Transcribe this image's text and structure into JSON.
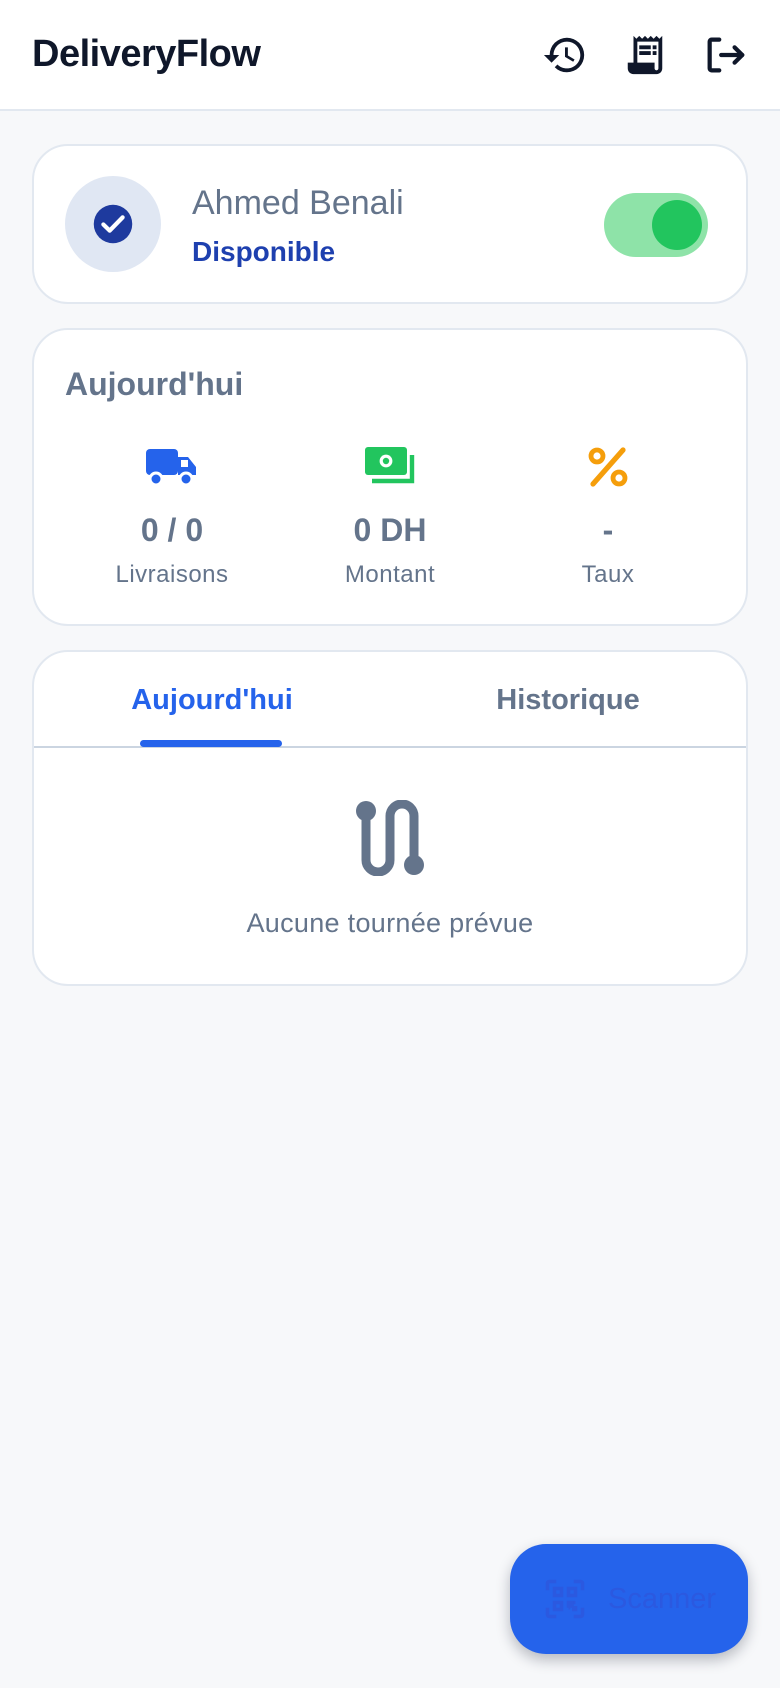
{
  "header": {
    "title": "DeliveryFlow",
    "actions": [
      "history-icon",
      "receipt-icon",
      "logout-icon"
    ]
  },
  "profile": {
    "name": "Ahmed Benali",
    "status": "Disponible",
    "available": true,
    "icon": "check-circle-icon"
  },
  "today": {
    "title": "Aujourd'hui",
    "stats": [
      {
        "icon": "truck-icon",
        "value": "0 / 0",
        "label": "Livraisons",
        "color": "#2563eb"
      },
      {
        "icon": "cash-icon",
        "value": "0 DH",
        "label": "Montant",
        "color": "#22c55e"
      },
      {
        "icon": "percent-icon",
        "value": "-",
        "label": "Taux",
        "color": "#f59e0b"
      }
    ]
  },
  "tabs": {
    "items": [
      "Aujourd'hui",
      "Historique"
    ],
    "active": "Aujourd'hui",
    "empty_icon": "route-icon",
    "empty_text": "Aucune tournée prévue"
  },
  "fab": {
    "label": "Scanner",
    "icon": "qr-code-icon"
  },
  "colors": {
    "primary": "#2563eb",
    "success": "#22c55e",
    "warning": "#f59e0b",
    "muted": "#64748b"
  }
}
